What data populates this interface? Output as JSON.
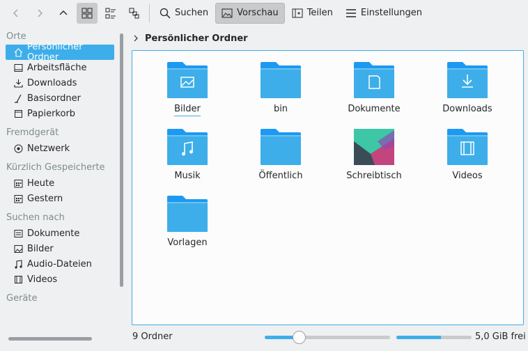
{
  "toolbar": {
    "back_icon": "chevron-left-icon",
    "forward_icon": "chevron-right-icon",
    "up_icon": "chevron-up-icon",
    "view_modes": [
      "icons-view",
      "compact-view",
      "details-view"
    ],
    "search_label": "Suchen",
    "preview_label": "Vorschau",
    "split_label": "Teilen",
    "settings_label": "Einstellungen"
  },
  "sidebar": {
    "places": {
      "title": "Orte",
      "items": [
        {
          "label": "Persönlicher Ordner",
          "icon": "home-icon"
        },
        {
          "label": "Arbeitsfläche",
          "icon": "desktop-icon"
        },
        {
          "label": "Downloads",
          "icon": "download-icon"
        },
        {
          "label": "Basisordner",
          "icon": "root-folder-icon"
        },
        {
          "label": "Papierkorb",
          "icon": "trash-icon"
        }
      ]
    },
    "remote": {
      "title": "Fremdgerät",
      "items": [
        {
          "label": "Netzwerk",
          "icon": "network-icon"
        }
      ]
    },
    "recent": {
      "title": "Kürzlich Gespeicherte",
      "items": [
        {
          "label": "Heute",
          "icon": "calendar-icon"
        },
        {
          "label": "Gestern",
          "icon": "calendar-icon"
        }
      ]
    },
    "search": {
      "title": "Suchen nach",
      "items": [
        {
          "label": "Dokumente",
          "icon": "documents-icon"
        },
        {
          "label": "Bilder",
          "icon": "images-icon"
        },
        {
          "label": "Audio-Dateien",
          "icon": "audio-icon"
        },
        {
          "label": "Videos",
          "icon": "video-icon"
        }
      ]
    },
    "devices": {
      "title": "Geräte"
    }
  },
  "breadcrumb": {
    "current": "Persönlicher Ordner"
  },
  "files": [
    {
      "name": "Bilder",
      "emblem": "image"
    },
    {
      "name": "bin",
      "emblem": "none"
    },
    {
      "name": "Dokumente",
      "emblem": "document"
    },
    {
      "name": "Downloads",
      "emblem": "download"
    },
    {
      "name": "Musik",
      "emblem": "music"
    },
    {
      "name": "Öffentlich",
      "emblem": "none"
    },
    {
      "name": "Schreibtisch",
      "emblem": "wallpaper"
    },
    {
      "name": "Videos",
      "emblem": "video"
    },
    {
      "name": "Vorlagen",
      "emblem": "none"
    }
  ],
  "status": {
    "count_label": "9 Ordner",
    "free_space": "5,0 GiB frei",
    "space_used_fraction": 0.59,
    "zoom_fraction": 0.28
  },
  "colors": {
    "accent": "#3daee9",
    "folder_top": "#1d99f3",
    "folder_body": "#3daee9"
  }
}
